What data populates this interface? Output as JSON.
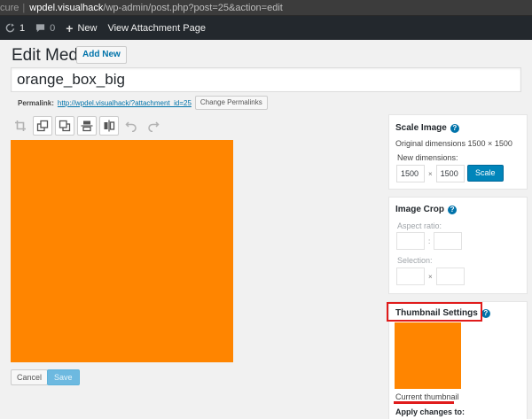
{
  "browser": {
    "security_text": "cure",
    "host": "wpdel.visualhack",
    "path": "/wp-admin/post.php?post=25&action=edit"
  },
  "admin_bar": {
    "updates_count": "1",
    "comments_count": "0",
    "new_label": "New",
    "view_label": "View Attachment Page"
  },
  "page": {
    "heading": "Edit Media",
    "add_new_label": "Add New",
    "title_value": "orange_box_big",
    "permalink_label": "Permalink:",
    "permalink_url": "http://wpdel.visualhack/?attachment_id=25",
    "change_permalinks_label": "Change Permalinks"
  },
  "editor": {
    "tools": [
      "crop-icon",
      "rotate-left-icon",
      "rotate-right-icon",
      "flip-vertical-icon",
      "flip-horizontal-icon",
      "undo-icon",
      "redo-icon"
    ],
    "image_color": "#ff8500",
    "cancel_label": "Cancel",
    "save_label": "Save"
  },
  "scale_image": {
    "title": "Scale Image",
    "original_text": "Original dimensions 1500 × 1500",
    "new_dimensions_label": "New dimensions:",
    "width_value": "1500",
    "height_value": "1500",
    "times_symbol": "×",
    "scale_label": "Scale"
  },
  "image_crop": {
    "title": "Image Crop",
    "aspect_ratio_label": "Aspect ratio:",
    "ratio_separator": ":",
    "selection_label": "Selection:",
    "times_symbol": "×"
  },
  "thumbnail": {
    "title": "Thumbnail Settings",
    "current_label": "Current thumbnail",
    "apply_label": "Apply changes to:",
    "highlight_color": "#e01b1b"
  },
  "colors": {
    "accent": "#0073aa",
    "primary_button": "#0085ba",
    "admin_bar": "#23282d",
    "background": "#f1f1f1"
  }
}
